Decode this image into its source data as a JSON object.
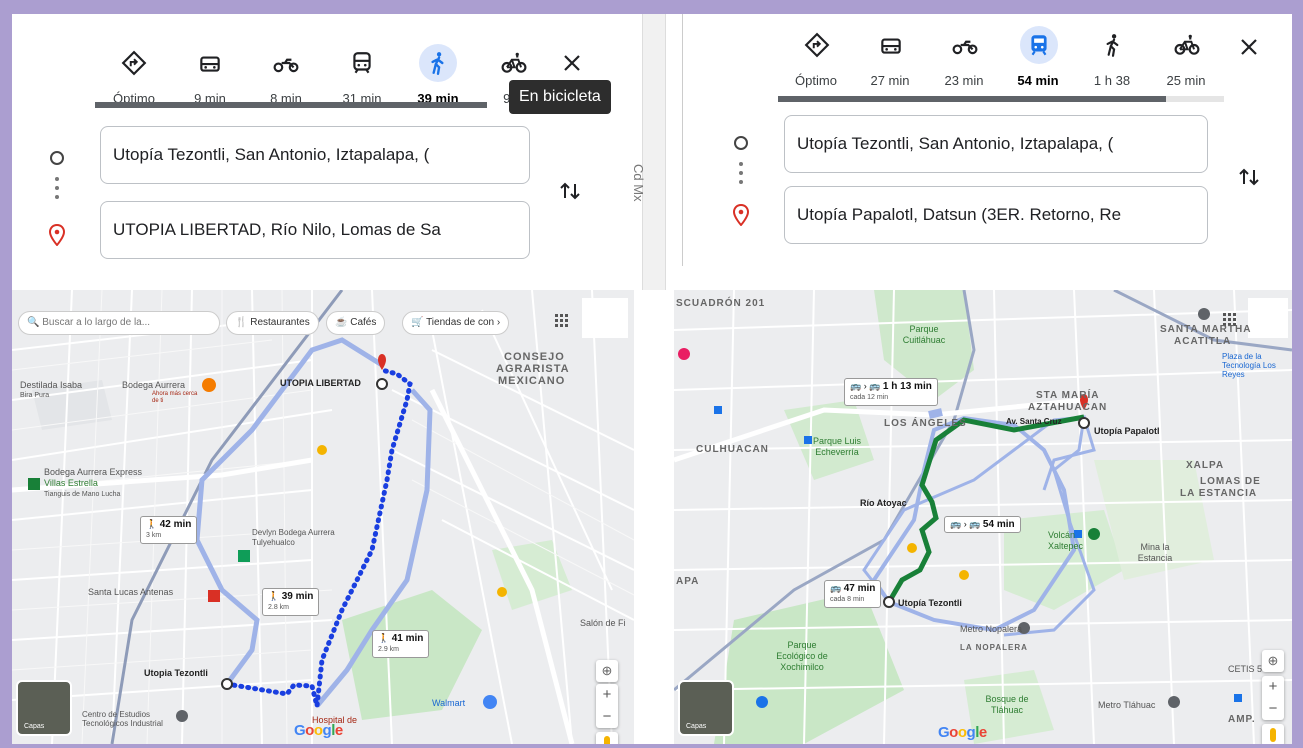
{
  "left": {
    "modes": [
      {
        "name": "optimo",
        "label": "Óptimo"
      },
      {
        "name": "car",
        "label": "9 min"
      },
      {
        "name": "motorcycle",
        "label": "8 min"
      },
      {
        "name": "transit",
        "label": "31 min"
      },
      {
        "name": "walk",
        "label": "39 min",
        "active": true
      },
      {
        "name": "bicycle",
        "label": "9 m"
      }
    ],
    "tooltip": "En bicicleta",
    "origin": "Utopía Tezontli, San Antonio, Iztapalapa, (",
    "destination": "UTOPIA LIBERTAD, Río Nilo, Lomas de Sa",
    "side_text": "Cd Mx",
    "map": {
      "search_placeholder": "Buscar a lo largo de la...",
      "chips": [
        "Restaurantes",
        "Cafés",
        "Tiendas de con"
      ],
      "labels": {
        "destilada": "Destilada Isaba",
        "destilada_sub": "Bira Pura",
        "bodega": "Bodega Aurrera",
        "bodega_sub": "Ahora más cerca de ti",
        "dest_name": "UTOPIA LIBERTAD",
        "consejo": "CONSEJO",
        "agrarista": "AGRARISTA",
        "mexicano": "MEXICANO",
        "bodega_exp": "Bodega Aurrera Express",
        "villas": "Villas Estrella",
        "tianguis": "Tianguis de Mano Lucha",
        "devlyn": "Devlyn Bodega Aurrera Tulyehualco",
        "antenas": "Santa Lucas Antenas",
        "origin_name": "Utopia Tezontli",
        "centro": "Centro de Estudios Tecnológicos Industrial",
        "hospital": "Hospital de",
        "walmart": "Walmart",
        "salon": "Salón de Fi",
        "layers": "Capas"
      },
      "bubbles": [
        {
          "time": "42 min",
          "dist": "3 km"
        },
        {
          "time": "39 min",
          "dist": "2.8 km"
        },
        {
          "time": "41 min",
          "dist": "2.9 km"
        }
      ]
    }
  },
  "right": {
    "modes": [
      {
        "name": "optimo",
        "label": "Óptimo"
      },
      {
        "name": "car",
        "label": "27 min"
      },
      {
        "name": "motorcycle",
        "label": "23 min"
      },
      {
        "name": "transit",
        "label": "54 min",
        "active": true
      },
      {
        "name": "walk",
        "label": "1 h 38"
      },
      {
        "name": "bicycle",
        "label": "25 min"
      }
    ],
    "origin": "Utopía Tezontli, San Antonio, Iztapalapa, (",
    "destination": "Utopía Papalotl, Datsun (3ER. Retorno, Re",
    "map": {
      "labels": {
        "escuadron": "SCUADRÓN 201",
        "parque_cuit": "Parque Cuitláhuac",
        "santa_martha": "SANTA MARTHA",
        "acatitla": "ACATITLA",
        "plaza": "Plaza de la Tecnología Los Reyes",
        "culhuacan": "CULHUACAN",
        "parque_luis": "Parque Luis Echeverría",
        "los_angeles": "LOS ÁNGELES",
        "sta_maria": "STA MARÍA",
        "aztahuacan": "AZTAHUACAN",
        "av_santa": "Av. Santa Cruz",
        "dest_name": "Utopía Papalotl",
        "xalpa": "XALPA",
        "lomas": "LOMAS DE",
        "estancia": "LA ESTANCIA",
        "rio_atoyac": "Río Atoyac",
        "volcan": "Volcán Xaltepec",
        "mina": "Mina la Estancia",
        "apa": "APA",
        "origin_name": "Utopía Tezontli",
        "metro_nopalera": "Metro Nopalera",
        "parque_eco": "Parque Ecológico de Xochimilco",
        "la_nopalera": "LA NOPALERA",
        "bosque": "Bosque de Tláhuac",
        "metro_tlahuac": "Metro Tláhuac",
        "cetis": "CETIS 5",
        "amp": "AMP.",
        "layers": "Capas"
      },
      "bubbles": [
        {
          "time": "1 h 13 min",
          "dist": "cada 12 min"
        },
        {
          "time": "54 min",
          "dist": ""
        },
        {
          "time": "47 min",
          "dist": "cada 8 min"
        }
      ]
    }
  },
  "colors": {
    "route_walk": "#1a3fe0",
    "route_transit": "#188038",
    "route_alt": "#9fb3e8",
    "frame": "#ab9ed0"
  }
}
